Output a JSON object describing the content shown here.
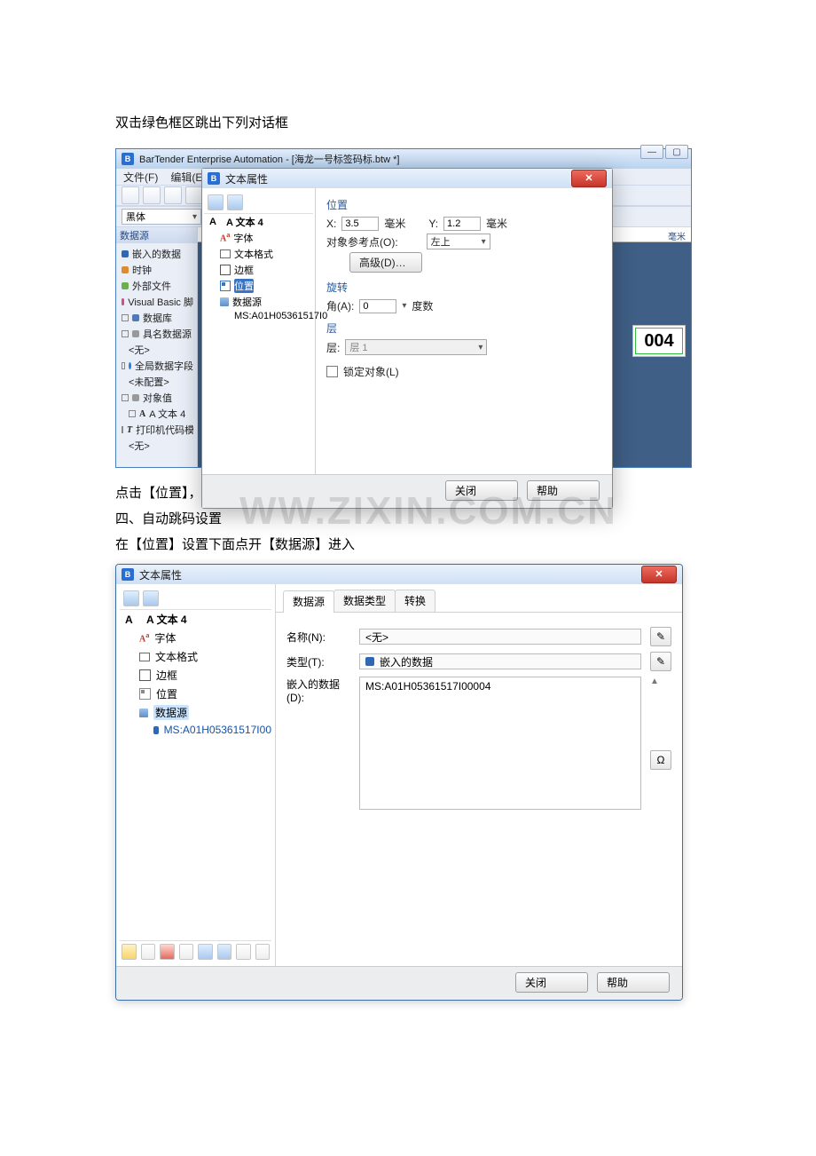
{
  "page_text": {
    "p1": "双击绿色框区跳出下列对话框",
    "p2": "点击【位置】，可以调整打印内容在打印纸区位置，直到调整满意为止",
    "p3": "四、自动跳码设置",
    "p4": "在【位置】设置下面点开【数据源】进入",
    "watermark": "WW.ZIXIN.COM.CN"
  },
  "app": {
    "title": "BarTender Enterprise Automation - [海龙一号标签码标.btw *]",
    "menus": {
      "file": "文件(F)",
      "edit": "编辑(E)"
    },
    "font_combo": "黑体",
    "ruler_unit": "毫米",
    "ds_panel": {
      "title": "数据源",
      "items": {
        "embedded": "嵌入的数据",
        "clock": "时钟",
        "external": "外部文件",
        "vbs": "Visual Basic 脚",
        "database": "数据库",
        "named": "具名数据源",
        "none1": "<无>",
        "global": "全局数据字段",
        "unconfigured": "<未配置>",
        "objvalue": "对象值",
        "text4": "A 文本 4",
        "printer_tpl": "打印机代码模板",
        "none2": "<无>"
      }
    },
    "canvas_badge": "004"
  },
  "dialog1": {
    "title": "文本属性",
    "tree": {
      "root": "A 文本 4",
      "font": "字体",
      "textfmt": "文本格式",
      "border": "边框",
      "position": "位置",
      "datasource": "数据源",
      "ms_item": "MS:A01H05361517I0"
    },
    "right": {
      "sect_position": "位置",
      "x_lbl": "X:",
      "x_val": "3.5",
      "x_unit": "毫米",
      "y_lbl": "Y:",
      "y_val": "1.2",
      "y_unit": "毫米",
      "ref_lbl": "对象参考点(O):",
      "ref_val": "左上",
      "adv_btn": "高级(D)…",
      "sect_rotate": "旋转",
      "angle_lbl": "角(A):",
      "angle_val": "0",
      "angle_unit": "度数",
      "sect_layer": "层",
      "layer_lbl": "层:",
      "layer_val": "层 1",
      "lock_lbl": "锁定对象(L)"
    },
    "close_btn": "关闭",
    "help_btn": "帮助"
  },
  "dialog2": {
    "title": "文本属性",
    "tree": {
      "root": "A 文本 4",
      "font": "字体",
      "textfmt": "文本格式",
      "border": "边框",
      "position": "位置",
      "datasource": "数据源",
      "ms_item": "MS:A01H05361517I00"
    },
    "tabs": {
      "ds": "数据源",
      "type": "数据类型",
      "trans": "转换"
    },
    "form": {
      "name_lbl": "名称(N):",
      "name_val": "<无>",
      "type_lbl": "类型(T):",
      "type_val": "嵌入的数据",
      "embed_lbl": "嵌入的数据(D):",
      "embed_val": "MS:A01H05361517I00004",
      "omega": "Ω"
    },
    "close_btn": "关闭",
    "help_btn": "帮助"
  }
}
